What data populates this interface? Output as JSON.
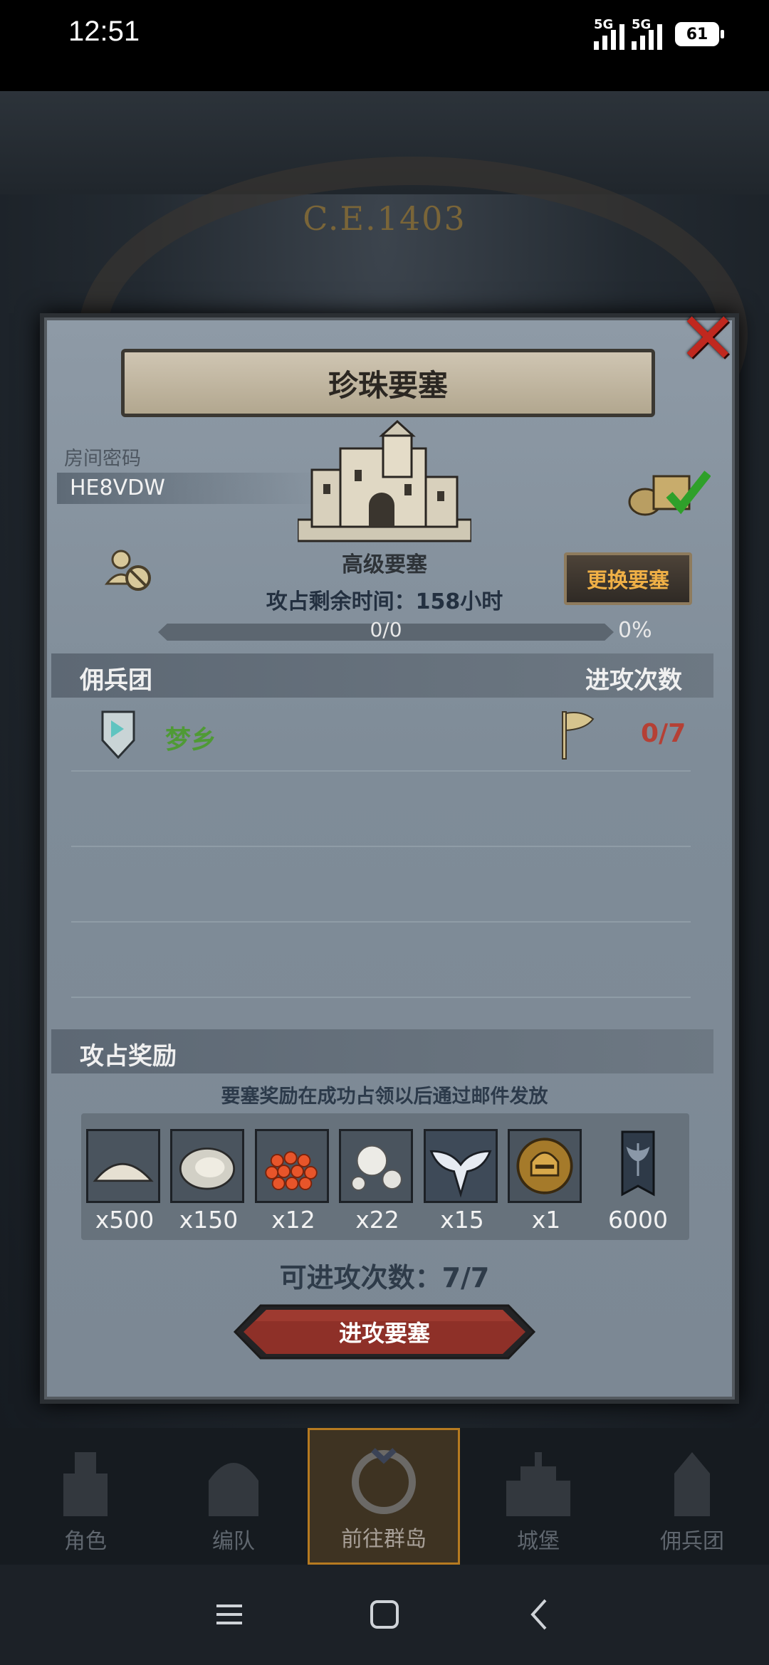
{
  "status_bar": {
    "time": "12:51",
    "network_1": "5G",
    "network_2": "5G",
    "battery": "61"
  },
  "background": {
    "era_label": "C.E.1403"
  },
  "dialog": {
    "title": "珍珠要塞",
    "close_icon": "close-icon",
    "room_label": "房间密码",
    "room_code": "HE8VDW",
    "fortress_type": "高级要塞",
    "change_button": "更换要塞",
    "conquer_time": "攻占剩余时间：158小时",
    "progress": {
      "text": "0/0",
      "percent_label": "0%",
      "fraction": 0
    },
    "mercenary_header": "佣兵团",
    "attack_count_header": "进攻次数",
    "guild": {
      "name": "梦乡",
      "attack_count": "0/7"
    },
    "rewards_header": "攻占奖励",
    "rewards_note": "要塞奖励在成功占领以后通过邮件发放",
    "rewards": [
      {
        "icon": "salt-pile-icon",
        "qty": "x500"
      },
      {
        "icon": "oyster-icon",
        "qty": "x150"
      },
      {
        "icon": "fish-roe-icon",
        "qty": "x12"
      },
      {
        "icon": "pearl-icon",
        "qty": "x22"
      },
      {
        "icon": "winged-emblem-icon",
        "qty": "x15"
      },
      {
        "icon": "golden-helmet-icon",
        "qty": "x1"
      },
      {
        "icon": "axe-banner-icon",
        "qty": "6000"
      }
    ],
    "attempts_left": "可进攻次数：7/7",
    "attack_button": "进攻要塞"
  },
  "game_nav": [
    {
      "label": "角色"
    },
    {
      "label": "编队"
    },
    {
      "label": "前往群岛",
      "active": true
    },
    {
      "label": "城堡"
    },
    {
      "label": "佣兵团"
    }
  ],
  "colors": {
    "accent_gold": "#f0b046",
    "guild_green": "#4f9a35",
    "attack_red": "#b54035",
    "close_red": "#c0281f"
  }
}
